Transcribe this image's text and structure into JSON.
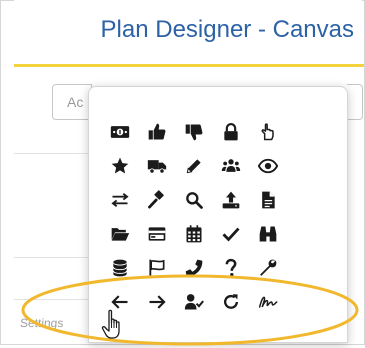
{
  "header": {
    "title": "Plan Designer - Canvas"
  },
  "search_input": {
    "value": "Ac"
  },
  "left_panel": {
    "settings_label": "Settings"
  },
  "icon_picker": {
    "icons": [
      "money-bill-icon",
      "thumbs-up-icon",
      "thumbs-down-icon",
      "lock-icon",
      "pointer-hand-icon",
      "star-icon",
      "truck-icon",
      "pencil-icon",
      "users-icon",
      "eye-icon",
      "exchange-arrows-icon",
      "gavel-icon",
      "search-icon",
      "upload-icon",
      "file-icon",
      "folder-open-icon",
      "credit-card-icon",
      "calendar-icon",
      "check-icon",
      "binoculars-icon",
      "database-icon",
      "flag-icon",
      "phone-icon",
      "question-icon",
      "wrench-icon",
      "arrow-left-icon",
      "arrow-right-icon",
      "user-check-icon",
      "redo-icon",
      "signature-icon"
    ]
  },
  "colors": {
    "title_blue": "#2d62a6",
    "accent_yellow": "#f4d23c",
    "highlight_ellipse": "#f1b82d",
    "icon_color": "#1b1b1b"
  }
}
